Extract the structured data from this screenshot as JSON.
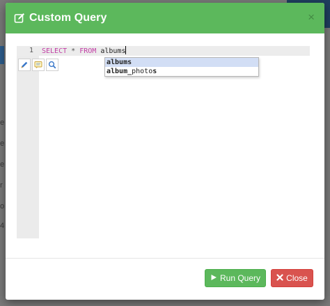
{
  "background": {
    "fragments": [
      "e",
      "e",
      "e",
      "r",
      "o",
      "4"
    ]
  },
  "modal": {
    "title": "Custom Query",
    "close_symbol": "×",
    "header_color": "#5cb85c"
  },
  "editor": {
    "line_number": "1",
    "code": {
      "select": "SELECT",
      "star": "*",
      "from": "FROM",
      "table": "albums"
    },
    "toolbar_icons": [
      "pencil-icon",
      "comment-icon",
      "search-icon"
    ],
    "autocomplete": [
      {
        "match": "albums",
        "rest": "",
        "selected": true
      },
      {
        "match": "album_",
        "rest": "photo",
        "tail": "s",
        "selected": false
      }
    ]
  },
  "footer": {
    "run_label": "Run Query",
    "close_label": "Close",
    "run_color": "#5cb85c",
    "close_color": "#d9534f"
  }
}
